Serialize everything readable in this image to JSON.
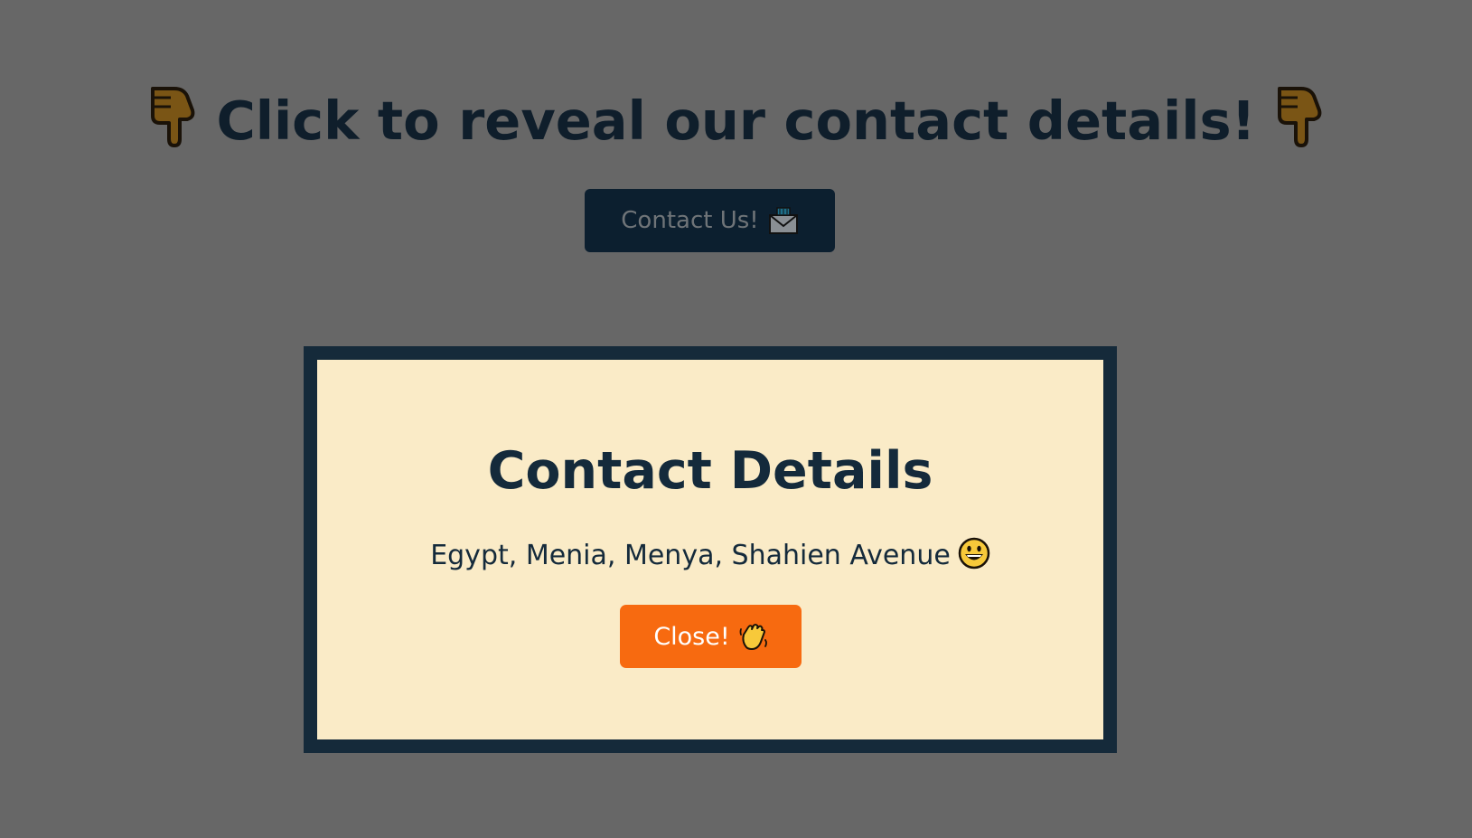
{
  "header": {
    "title": "Click to reveal our contact details!",
    "left_icon": "pointing-down-hand-icon",
    "right_icon": "pointing-down-hand-icon"
  },
  "contact_button": {
    "label": "Contact Us!",
    "icon": "envelope-icon"
  },
  "modal": {
    "title": "Contact Details",
    "address": "Egypt, Menia, Menya, Shahien Avenue",
    "address_icon": "smiley-face-icon",
    "close_button": {
      "label": "Close!",
      "icon": "waving-hand-icon"
    }
  },
  "colors": {
    "page_background": "#676767",
    "heading_text": "#0f1e2b",
    "contact_button_bg": "#0c1f2f",
    "modal_border": "#152a3a",
    "modal_background": "#faebc7",
    "close_button_bg": "#f76a10"
  }
}
